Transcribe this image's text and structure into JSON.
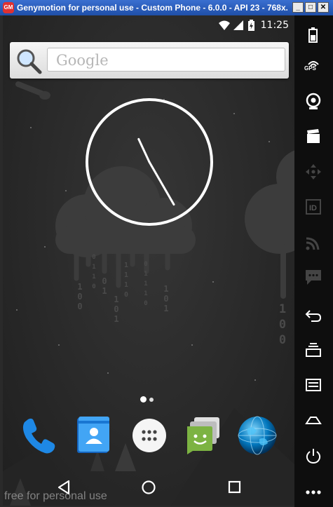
{
  "window": {
    "title": "Genymotion for personal use - Custom Phone - 6.0.0 - API 23 - 768x...",
    "icon_label": "GM",
    "minimize": "_",
    "maximize": "□",
    "close": "✕"
  },
  "status_bar": {
    "time": "11:25"
  },
  "search": {
    "placeholder": "Google"
  },
  "clock": {
    "hour_hand_deg": 335,
    "minute_hand_deg": 150
  },
  "wallpaper": {
    "binary_columns": [
      "100",
      "0110",
      "01",
      "1110",
      "101",
      "01110",
      "101",
      "100"
    ]
  },
  "page_indicator": {
    "pages": 2,
    "current": 1
  },
  "dock": [
    "phone-icon",
    "contacts-icon",
    "apps-icon",
    "messenger-icon",
    "browser-icon"
  ],
  "navigation": [
    "back-icon",
    "home-icon",
    "recents-icon"
  ],
  "watermark": "free for personal use",
  "sidebar": [
    "battery-icon",
    "gps-icon",
    "webcam-icon",
    "video-icon",
    "dpad-icon",
    "identifiers-icon",
    "cast-icon",
    "sms-icon",
    "back-icon",
    "recents-icon",
    "menu-icon",
    "home-icon",
    "power-icon",
    "more-icon"
  ],
  "sidebar_gps_label": "GPS",
  "sidebar_id_label": "ID",
  "colors": {
    "titlebar": "#2f62c4",
    "sidebar": "#0e0e0e",
    "wallpaper": "#2a2a2a",
    "phone_call": "#1e88e5",
    "messenger": "#7cb342"
  }
}
